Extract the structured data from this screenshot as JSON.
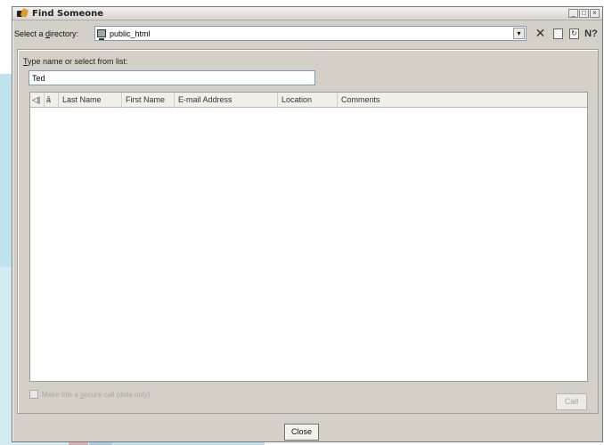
{
  "window": {
    "title": "Find Someone",
    "controls": [
      "_",
      "□",
      "×"
    ]
  },
  "directory": {
    "label_prefix": "Select a ",
    "label_accel": "d",
    "label_suffix": "irectory:",
    "value": "public_html"
  },
  "toolbar": {
    "delete_glyph": "✕",
    "properties_glyph": "",
    "refresh_glyph": "↻",
    "help_glyph": "N?"
  },
  "search": {
    "label_accel": "T",
    "label_rest": "ype name or select from list:",
    "value": "Ted"
  },
  "list": {
    "columns": [
      "Last Name",
      "First Name",
      "E-mail Address",
      "Location",
      "Comments"
    ],
    "icon_columns": [
      "◁|",
      "ā"
    ]
  },
  "secure": {
    "label_pre": "Make this a ",
    "label_accel": "s",
    "label_post": "ecure call (data only)",
    "checked": false
  },
  "buttons": {
    "call": "Call",
    "close": "Close"
  },
  "colors": {
    "dialog": "#d4d0c8",
    "watermark": "#bfe3ec"
  }
}
